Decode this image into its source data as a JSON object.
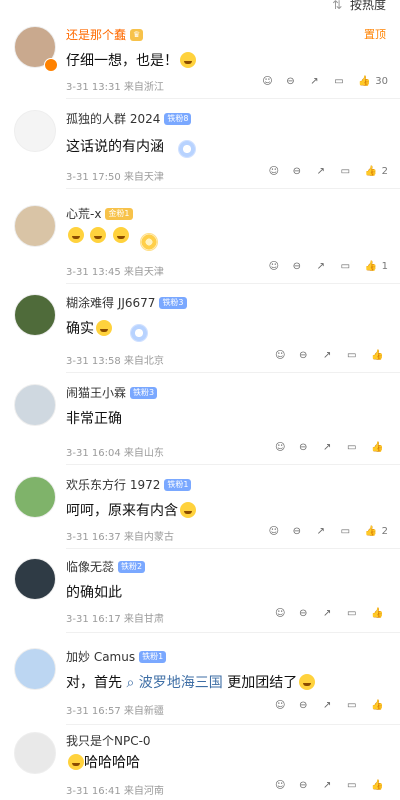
{
  "top": {
    "sort_label": "按热度"
  },
  "comments": [
    {
      "username": "还是那个蠢",
      "badge": "",
      "pinned": "置顶",
      "text": "仔细一想，也是！",
      "date": "3-31 13:31",
      "location": "来自浙江",
      "likes": "30"
    },
    {
      "username": "孤独的人群 2024",
      "badge": "铁粉8",
      "text": "这话说的有内涵",
      "date": "3-31 17:50",
      "location": "来自天津",
      "likes": "2"
    },
    {
      "username": "心荒-x",
      "badge": "金粉1",
      "text": "",
      "date": "3-31 13:45",
      "location": "来自天津",
      "likes": "1"
    },
    {
      "username": "糊涂难得 JJ6677",
      "badge": "铁粉3",
      "text": "确实",
      "date": "3-31 13:58",
      "location": "来自北京",
      "likes": ""
    },
    {
      "username": "闹猫王小霖",
      "badge": "铁粉3",
      "text": "非常正确",
      "date": "3-31 16:04",
      "location": "来自山东",
      "likes": ""
    },
    {
      "username": "欢乐东方行 1972",
      "badge": "铁粉1",
      "text": "呵呵，原来有内含",
      "date": "3-31 16:37",
      "location": "来自内蒙古",
      "likes": "2"
    },
    {
      "username": "临像无蕊",
      "badge": "铁粉2",
      "text": "的确如此",
      "date": "3-31 16:17",
      "location": "来自甘肃",
      "likes": ""
    },
    {
      "username": "加妙 Camus",
      "badge": "铁粉1",
      "text_pre": "对，首先",
      "text_link": "波罗地海三国",
      "text_post": "更加团结了",
      "date": "3-31 16:57",
      "location": "来自新疆",
      "likes": ""
    },
    {
      "username": "我只是个NPC-0",
      "badge": "",
      "text": "哈哈哈哈",
      "date": "3-31 16:41",
      "location": "来自河南",
      "likes": ""
    }
  ]
}
